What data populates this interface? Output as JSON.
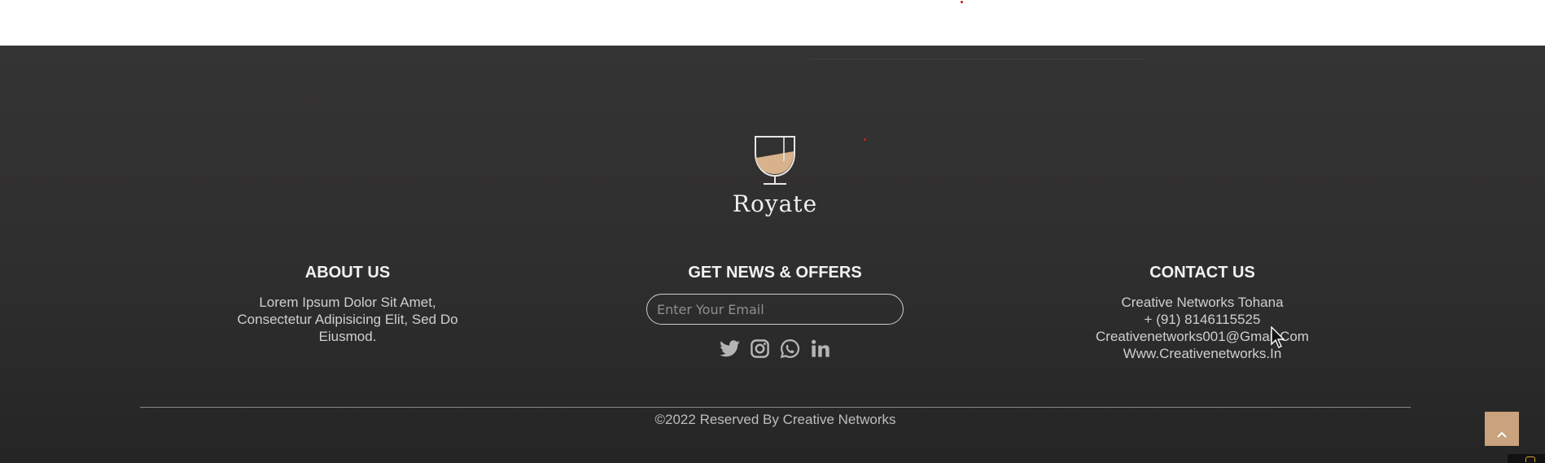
{
  "brand": {
    "name": "Royate",
    "logo_icon": "wine-glass-icon",
    "logo_fill_color": "#d7b28a"
  },
  "about": {
    "heading": "ABOUT US",
    "text": "Lorem Ipsum Dolor Sit Amet, Consectetur Adipisicing Elit, Sed Do Eiusmod."
  },
  "news": {
    "heading": "GET NEWS & OFFERS",
    "email_placeholder": "Enter Your Email",
    "social": [
      {
        "icon": "twitter-icon"
      },
      {
        "icon": "instagram-icon"
      },
      {
        "icon": "whatsapp-icon"
      },
      {
        "icon": "linkedin-icon"
      }
    ]
  },
  "contact": {
    "heading": "CONTACT US",
    "lines": [
      "Creative Networks Tohana",
      "+ (91) 8146115525",
      "Creativenetworks001@Gmail.Com",
      "Www.Creativenetworks.In"
    ]
  },
  "footer": {
    "copyright": "©2022 Reserved By Creative Networks",
    "back_to_top_icon": "chevron-up-icon"
  },
  "colors": {
    "background": "#333232",
    "accent": "#c9a27e",
    "text": "#cfcfcf"
  }
}
